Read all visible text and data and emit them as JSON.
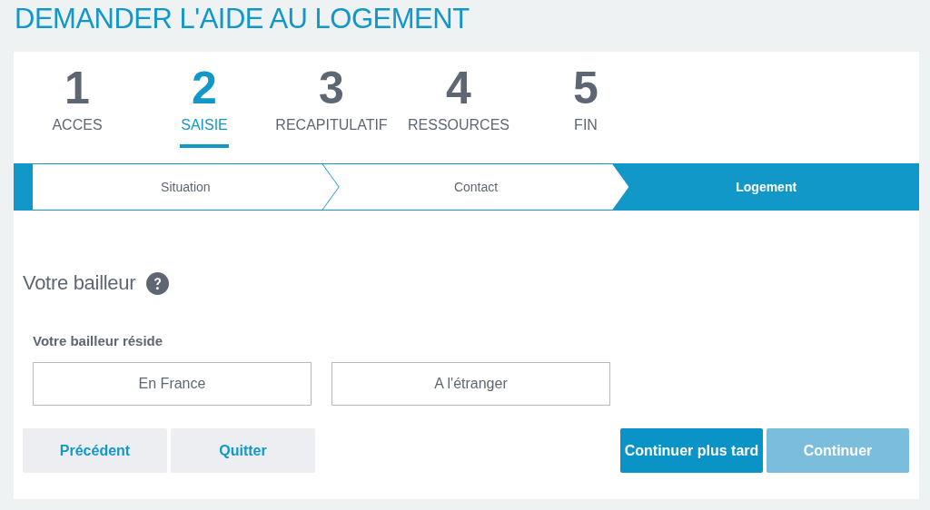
{
  "page_title": "DEMANDER L'AIDE AU LOGEMENT",
  "steps": [
    {
      "number": "1",
      "label": "ACCES",
      "selected": false
    },
    {
      "number": "2",
      "label": "SAISIE",
      "selected": true
    },
    {
      "number": "3",
      "label": "RECAPITULATIF",
      "selected": false
    },
    {
      "number": "4",
      "label": "RESSOURCES",
      "selected": false
    },
    {
      "number": "5",
      "label": "FIN",
      "selected": false
    }
  ],
  "substeps": [
    {
      "label": "Situation",
      "selected": false
    },
    {
      "label": "Contact",
      "selected": false
    },
    {
      "label": "Logement",
      "selected": true
    }
  ],
  "section": {
    "title": "Votre bailleur",
    "question": "Votre bailleur réside",
    "options": [
      {
        "label": "En France",
        "selected": false
      },
      {
        "label": "A l'étranger",
        "selected": false
      }
    ]
  },
  "buttons": {
    "left": [
      {
        "label": "Précédent",
        "kind": "secondary",
        "disabled": false
      },
      {
        "label": "Quitter",
        "kind": "secondary",
        "disabled": false
      }
    ],
    "right": [
      {
        "label": "Continuer plus tard",
        "kind": "primary",
        "disabled": false
      },
      {
        "label": "Continuer",
        "kind": "primary",
        "disabled": true
      }
    ]
  }
}
